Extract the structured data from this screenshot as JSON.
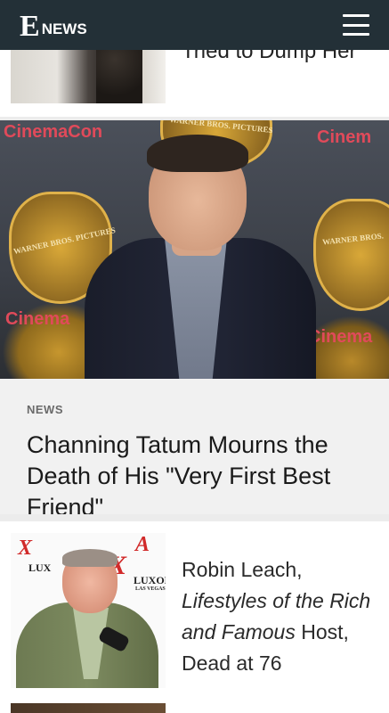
{
  "header": {
    "logo_e": "E",
    "logo_news": "NEWS",
    "menu_icon": "hamburger-menu-icon"
  },
  "stories": {
    "top": {
      "title": "Tried to Dump Her"
    },
    "hero": {
      "kicker": "NEWS",
      "headline": "Channing Tatum Mourns the Death of His \"Very First Best Friend\"",
      "backdrop": {
        "cinemacon_left_top": "CinemaCon",
        "cinemacon_left_bottom": "Cinema",
        "cinemacon_right_top": "Cinem",
        "cinemacon_right_bottom": "Cinema",
        "wb_left": "WARNER BROS. PICTURES",
        "wb_center": "WARNER BROS. PICTURES",
        "wb_right": "WARNER BROS."
      }
    },
    "bottom": {
      "title_pre": "Robin Leach, ",
      "title_italic": "Lifestyles of the Rich and Famous",
      "title_post": " Host, Dead at 76",
      "backdrop": {
        "luxor_left": "LUX",
        "luxor_right": "LUXOR",
        "las_vegas": "LAS VEGAS"
      }
    }
  },
  "colors": {
    "header_bg": "#233037",
    "cinemacon_red": "#e04a5a",
    "wb_gold": "#c6962e"
  }
}
